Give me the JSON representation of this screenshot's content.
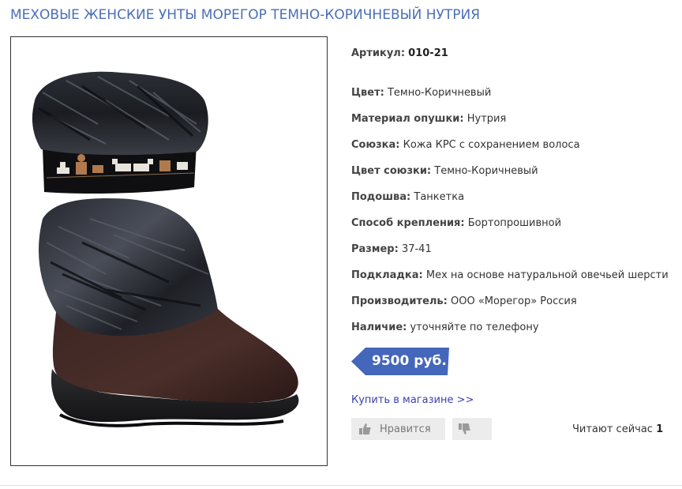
{
  "product": {
    "title": "МЕХОВЫЕ ЖЕНСКИЕ УНТЫ МОРЕГОР ТЕМНО-КОРИЧНЕВЫЙ НУТРИЯ"
  },
  "properties": [
    {
      "key": "Артикул:",
      "value": "010-21"
    },
    {
      "key": "Цвет:",
      "value": "Темно-Коричневый"
    },
    {
      "key": "Материал опушки:",
      "value": "Нутрия"
    },
    {
      "key": "Союзка:",
      "value": "Кожа КРС с сохранением волоса"
    },
    {
      "key": "Цвет союзки:",
      "value": "Темно-Коричневый"
    },
    {
      "key": "Подошва:",
      "value": "Танкетка"
    },
    {
      "key": "Способ крепления:",
      "value": "Бортопрошивной"
    },
    {
      "key": "Размер:",
      "value": "37-41"
    },
    {
      "key": "Подкладка:",
      "value": "Мех на основе натуральной овечьей шерсти"
    },
    {
      "key": "Производитель:",
      "value": "ООО «Морегор» Россия"
    },
    {
      "key": "Наличие:",
      "value": "уточняйте по телефону"
    }
  ],
  "price": {
    "label": "9500 руб.",
    "badge_color": "#4466bb"
  },
  "buy_link": {
    "label": "Купить в магазине >>"
  },
  "rating": {
    "like_label": "Нравится",
    "like_icon": "thumbs-up-icon",
    "dislike_icon": "thumbs-down-icon"
  },
  "reading_now": {
    "label": "Читают сейчас",
    "count": "1"
  },
  "colors": {
    "title": "#4a6fb5",
    "link": "#3a3fb0",
    "button_bg": "#ececec"
  }
}
